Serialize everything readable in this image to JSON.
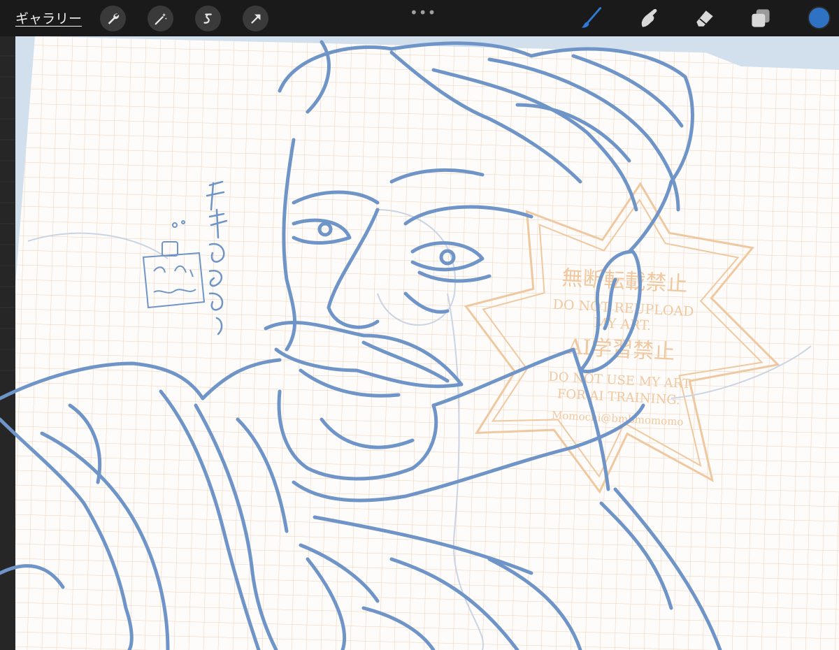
{
  "toolbar": {
    "gallery_label": "ギャラリー",
    "left_tools": [
      "wrench-icon",
      "magic-wand-icon",
      "selection-icon",
      "transform-arrow-icon"
    ],
    "right_tools": [
      "brush-icon",
      "smudge-icon",
      "eraser-icon",
      "layers-icon"
    ],
    "more_menu": "•••",
    "active_tool": "brush-icon"
  },
  "colors": {
    "accent": "#2f7ad9",
    "current_color": "#2f72c4",
    "sketch_line": "#6f95c8",
    "grid": "#f1cfb4",
    "stamp": "#f0c8a0",
    "canvas_border": "#d2e0ee"
  },
  "stamp": {
    "line1": "無断転載禁止",
    "line2": "DO NOT REUPLOAD",
    "line3": "MY ART.",
    "line4": "AI学習禁止",
    "line5": "DO NOT USE MY ART",
    "line6": "FOR AI TRAINING.",
    "line7": "Momochi@bmbmomomo"
  }
}
